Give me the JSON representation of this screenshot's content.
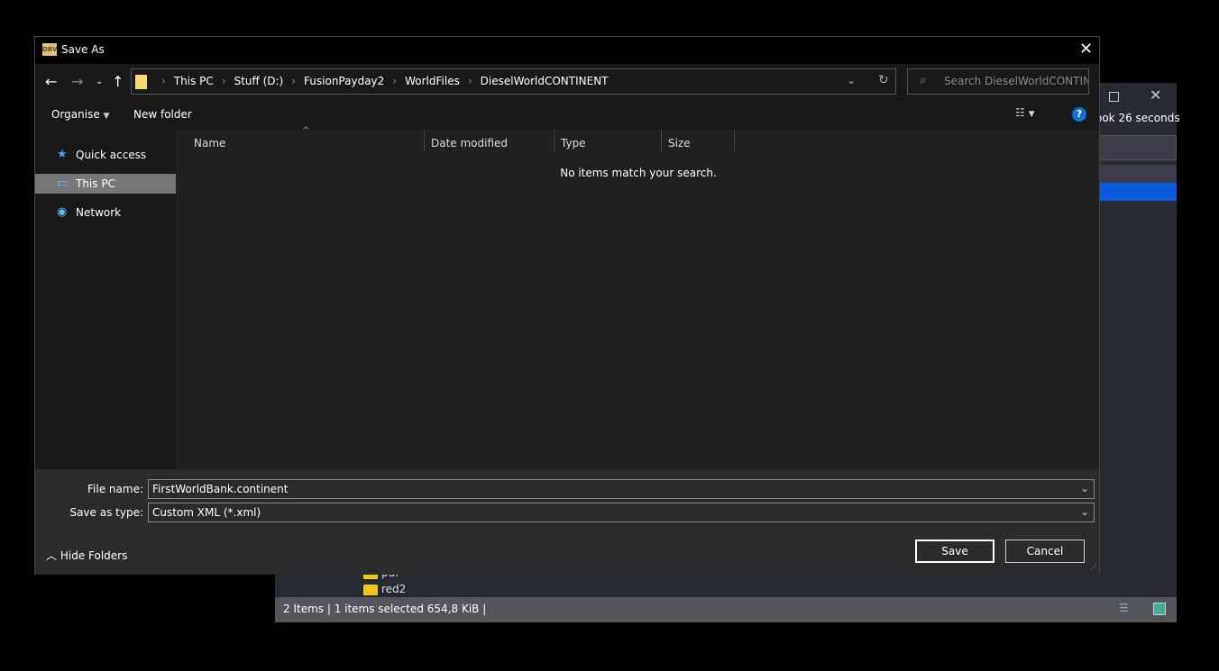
{
  "background_window": {
    "time_text": "ook 26 seconds",
    "tree_items": [
      "pdf",
      "red2"
    ],
    "status": "2 Items | 1 items selected 654,8 KiB |"
  },
  "dialog": {
    "app_icon_text": "DBV",
    "title": "Save As",
    "breadcrumbs": [
      "This PC",
      "Stuff (D:)",
      "FusionPayday2",
      "WorldFiles",
      "DieselWorldCONTINENT"
    ],
    "search_placeholder": "Search DieselWorldCONTINE...",
    "toolbar": {
      "organise": "Organise",
      "new_folder": "New folder",
      "help": "?"
    },
    "nav": [
      {
        "label": "Quick access",
        "icon": "star-icon"
      },
      {
        "label": "This PC",
        "icon": "computer-icon",
        "active": true
      },
      {
        "label": "Network",
        "icon": "network-icon"
      }
    ],
    "columns": [
      "Name",
      "Date modified",
      "Type",
      "Size"
    ],
    "empty_message": "No items match your search.",
    "file_name_label": "File name:",
    "file_name": "FirstWorldBank.continent",
    "save_type_label": "Save as type:",
    "save_type": "Custom XML (*.xml)",
    "hide_folders": "Hide Folders",
    "save": "Save",
    "cancel": "Cancel"
  }
}
